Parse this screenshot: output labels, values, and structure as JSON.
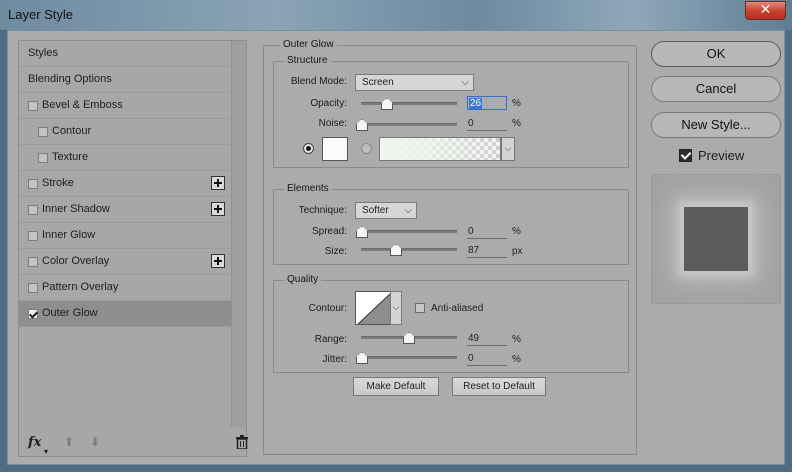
{
  "window": {
    "title": "Layer Style",
    "close_glyph": "✕"
  },
  "styles_list": {
    "items": [
      {
        "label": "Styles",
        "checkbox": false,
        "checked": false,
        "indent": 0,
        "add": false
      },
      {
        "label": "Blending Options",
        "checkbox": false,
        "checked": false,
        "indent": 0,
        "add": false
      },
      {
        "label": "Bevel & Emboss",
        "checkbox": true,
        "checked": false,
        "indent": 0,
        "add": false
      },
      {
        "label": "Contour",
        "checkbox": true,
        "checked": false,
        "indent": 1,
        "add": false
      },
      {
        "label": "Texture",
        "checkbox": true,
        "checked": false,
        "indent": 1,
        "add": false
      },
      {
        "label": "Stroke",
        "checkbox": true,
        "checked": false,
        "indent": 0,
        "add": true
      },
      {
        "label": "Inner Shadow",
        "checkbox": true,
        "checked": false,
        "indent": 0,
        "add": true
      },
      {
        "label": "Inner Glow",
        "checkbox": true,
        "checked": false,
        "indent": 0,
        "add": false
      },
      {
        "label": "Color Overlay",
        "checkbox": true,
        "checked": false,
        "indent": 0,
        "add": true
      },
      {
        "label": "Pattern Overlay",
        "checkbox": true,
        "checked": false,
        "indent": 0,
        "add": false
      },
      {
        "label": "Outer Glow",
        "checkbox": true,
        "checked": true,
        "indent": 0,
        "add": false,
        "selected": true
      }
    ],
    "bottom": {
      "fx_label": "fx",
      "up_glyph": "⬆",
      "down_glyph": "⬇",
      "trash_glyph": "🗑"
    }
  },
  "outer_glow": {
    "title": "Outer Glow",
    "structure": {
      "title": "Structure",
      "blend_mode": {
        "label": "Blend Mode:",
        "value": "Screen"
      },
      "opacity": {
        "label": "Opacity:",
        "value": "26",
        "unit": "%",
        "fraction": 0.26
      },
      "noise": {
        "label": "Noise:",
        "value": "0",
        "unit": "%",
        "fraction": 0.0
      },
      "glow_color": "#fbfbfb"
    },
    "elements": {
      "title": "Elements",
      "technique": {
        "label": "Technique:",
        "value": "Softer"
      },
      "spread": {
        "label": "Spread:",
        "value": "0",
        "unit": "%",
        "fraction": 0.0
      },
      "size": {
        "label": "Size:",
        "value": "87",
        "unit": "px",
        "fraction": 0.35
      }
    },
    "quality": {
      "title": "Quality",
      "contour": {
        "label": "Contour:"
      },
      "anti_aliased": {
        "label": "Anti-aliased",
        "checked": false
      },
      "range": {
        "label": "Range:",
        "value": "49",
        "unit": "%",
        "fraction": 0.49
      },
      "jitter": {
        "label": "Jitter:",
        "value": "0",
        "unit": "%",
        "fraction": 0.0
      }
    },
    "make_default": "Make Default",
    "reset_default": "Reset to Default"
  },
  "right": {
    "ok": "OK",
    "cancel": "Cancel",
    "new_style": "New Style...",
    "preview_label": "Preview",
    "preview_checked": true
  },
  "colors": {
    "selection": "#8e8e8e",
    "dialog_bg": "#ababab",
    "accent": "#3a78d8"
  }
}
